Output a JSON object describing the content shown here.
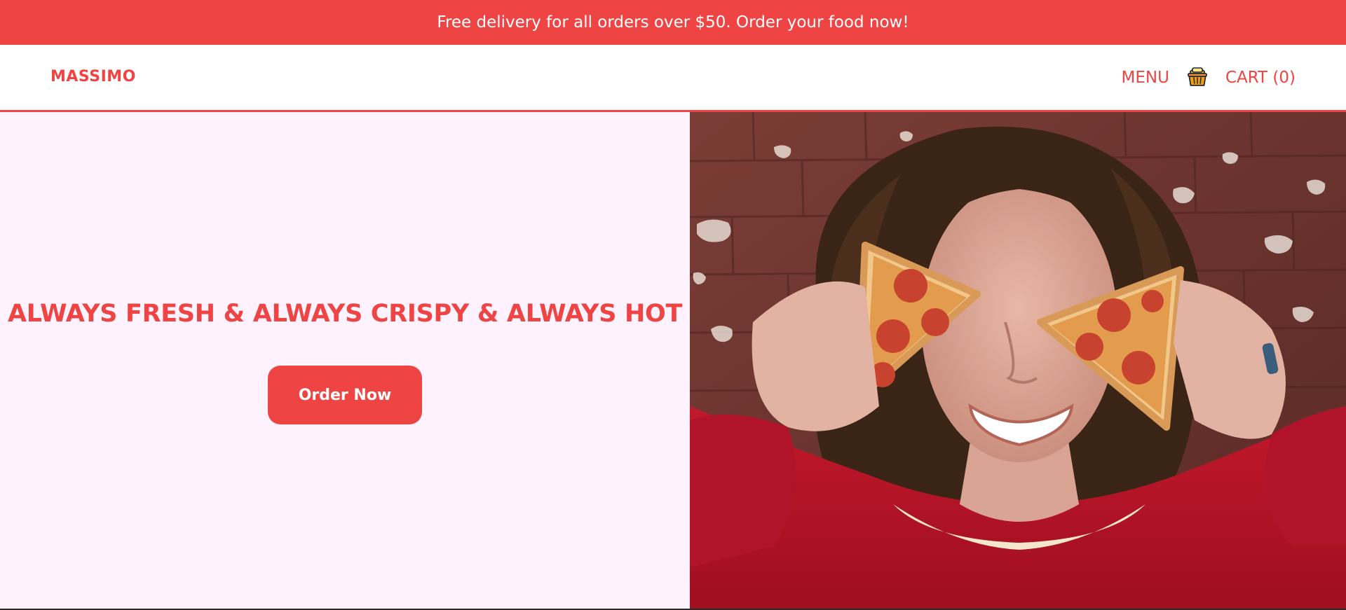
{
  "promo": {
    "text": "Free delivery for all orders over $50. Order your food now!"
  },
  "header": {
    "brand": "MASSIMO",
    "nav": {
      "menu_label": "MENU",
      "cart_label": "CART (0)",
      "cart_icon": "basket-icon"
    }
  },
  "hero": {
    "title": "ALWAYS FRESH & ALWAYS CRISPY & ALWAYS HOT",
    "cta_label": "Order Now",
    "image_subject": "person holding two pepperoni pizza slices over eyes"
  },
  "colors": {
    "accent": "#ef4444",
    "hero_background": "#fdf2fd",
    "header_background": "#ffffff",
    "text_on_accent": "#ffffff"
  }
}
